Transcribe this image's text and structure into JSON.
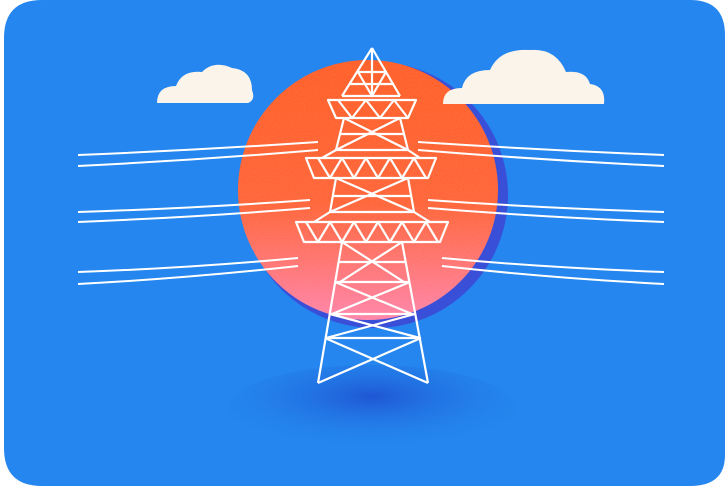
{
  "illustration": {
    "subject": "",
    "elements": [
      "sun-disc",
      "cloud-left",
      "cloud-right",
      "transmission-tower",
      "power-lines",
      "ground-shadow"
    ]
  },
  "colors": {
    "background": "#2486ee",
    "sun_top": "#ff5418",
    "sun_bottom": "#ff7ca4",
    "sun_shadow": "#3a4fd8",
    "cloud": "#fbf4ea",
    "line_art": "#ffffff",
    "ground_shadow": "#1f54d2"
  }
}
